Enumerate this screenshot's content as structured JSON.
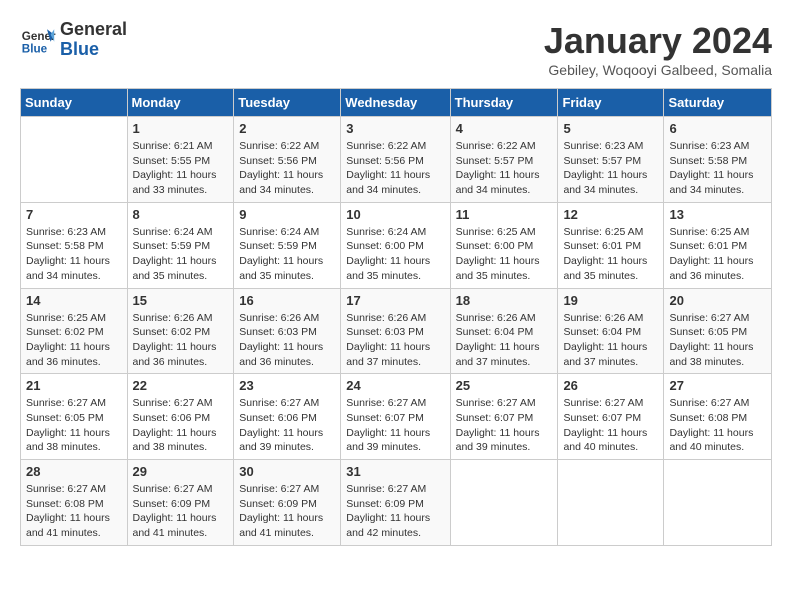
{
  "header": {
    "logo_line1": "General",
    "logo_line2": "Blue",
    "title": "January 2024",
    "location": "Gebiley, Woqooyi Galbeed, Somalia"
  },
  "columns": [
    "Sunday",
    "Monday",
    "Tuesday",
    "Wednesday",
    "Thursday",
    "Friday",
    "Saturday"
  ],
  "weeks": [
    [
      {
        "day": "",
        "info": ""
      },
      {
        "day": "1",
        "info": "Sunrise: 6:21 AM\nSunset: 5:55 PM\nDaylight: 11 hours\nand 33 minutes."
      },
      {
        "day": "2",
        "info": "Sunrise: 6:22 AM\nSunset: 5:56 PM\nDaylight: 11 hours\nand 34 minutes."
      },
      {
        "day": "3",
        "info": "Sunrise: 6:22 AM\nSunset: 5:56 PM\nDaylight: 11 hours\nand 34 minutes."
      },
      {
        "day": "4",
        "info": "Sunrise: 6:22 AM\nSunset: 5:57 PM\nDaylight: 11 hours\nand 34 minutes."
      },
      {
        "day": "5",
        "info": "Sunrise: 6:23 AM\nSunset: 5:57 PM\nDaylight: 11 hours\nand 34 minutes."
      },
      {
        "day": "6",
        "info": "Sunrise: 6:23 AM\nSunset: 5:58 PM\nDaylight: 11 hours\nand 34 minutes."
      }
    ],
    [
      {
        "day": "7",
        "info": "Sunrise: 6:23 AM\nSunset: 5:58 PM\nDaylight: 11 hours\nand 34 minutes."
      },
      {
        "day": "8",
        "info": "Sunrise: 6:24 AM\nSunset: 5:59 PM\nDaylight: 11 hours\nand 35 minutes."
      },
      {
        "day": "9",
        "info": "Sunrise: 6:24 AM\nSunset: 5:59 PM\nDaylight: 11 hours\nand 35 minutes."
      },
      {
        "day": "10",
        "info": "Sunrise: 6:24 AM\nSunset: 6:00 PM\nDaylight: 11 hours\nand 35 minutes."
      },
      {
        "day": "11",
        "info": "Sunrise: 6:25 AM\nSunset: 6:00 PM\nDaylight: 11 hours\nand 35 minutes."
      },
      {
        "day": "12",
        "info": "Sunrise: 6:25 AM\nSunset: 6:01 PM\nDaylight: 11 hours\nand 35 minutes."
      },
      {
        "day": "13",
        "info": "Sunrise: 6:25 AM\nSunset: 6:01 PM\nDaylight: 11 hours\nand 36 minutes."
      }
    ],
    [
      {
        "day": "14",
        "info": "Sunrise: 6:25 AM\nSunset: 6:02 PM\nDaylight: 11 hours\nand 36 minutes."
      },
      {
        "day": "15",
        "info": "Sunrise: 6:26 AM\nSunset: 6:02 PM\nDaylight: 11 hours\nand 36 minutes."
      },
      {
        "day": "16",
        "info": "Sunrise: 6:26 AM\nSunset: 6:03 PM\nDaylight: 11 hours\nand 36 minutes."
      },
      {
        "day": "17",
        "info": "Sunrise: 6:26 AM\nSunset: 6:03 PM\nDaylight: 11 hours\nand 37 minutes."
      },
      {
        "day": "18",
        "info": "Sunrise: 6:26 AM\nSunset: 6:04 PM\nDaylight: 11 hours\nand 37 minutes."
      },
      {
        "day": "19",
        "info": "Sunrise: 6:26 AM\nSunset: 6:04 PM\nDaylight: 11 hours\nand 37 minutes."
      },
      {
        "day": "20",
        "info": "Sunrise: 6:27 AM\nSunset: 6:05 PM\nDaylight: 11 hours\nand 38 minutes."
      }
    ],
    [
      {
        "day": "21",
        "info": "Sunrise: 6:27 AM\nSunset: 6:05 PM\nDaylight: 11 hours\nand 38 minutes."
      },
      {
        "day": "22",
        "info": "Sunrise: 6:27 AM\nSunset: 6:06 PM\nDaylight: 11 hours\nand 38 minutes."
      },
      {
        "day": "23",
        "info": "Sunrise: 6:27 AM\nSunset: 6:06 PM\nDaylight: 11 hours\nand 39 minutes."
      },
      {
        "day": "24",
        "info": "Sunrise: 6:27 AM\nSunset: 6:07 PM\nDaylight: 11 hours\nand 39 minutes."
      },
      {
        "day": "25",
        "info": "Sunrise: 6:27 AM\nSunset: 6:07 PM\nDaylight: 11 hours\nand 39 minutes."
      },
      {
        "day": "26",
        "info": "Sunrise: 6:27 AM\nSunset: 6:07 PM\nDaylight: 11 hours\nand 40 minutes."
      },
      {
        "day": "27",
        "info": "Sunrise: 6:27 AM\nSunset: 6:08 PM\nDaylight: 11 hours\nand 40 minutes."
      }
    ],
    [
      {
        "day": "28",
        "info": "Sunrise: 6:27 AM\nSunset: 6:08 PM\nDaylight: 11 hours\nand 41 minutes."
      },
      {
        "day": "29",
        "info": "Sunrise: 6:27 AM\nSunset: 6:09 PM\nDaylight: 11 hours\nand 41 minutes."
      },
      {
        "day": "30",
        "info": "Sunrise: 6:27 AM\nSunset: 6:09 PM\nDaylight: 11 hours\nand 41 minutes."
      },
      {
        "day": "31",
        "info": "Sunrise: 6:27 AM\nSunset: 6:09 PM\nDaylight: 11 hours\nand 42 minutes."
      },
      {
        "day": "",
        "info": ""
      },
      {
        "day": "",
        "info": ""
      },
      {
        "day": "",
        "info": ""
      }
    ]
  ]
}
